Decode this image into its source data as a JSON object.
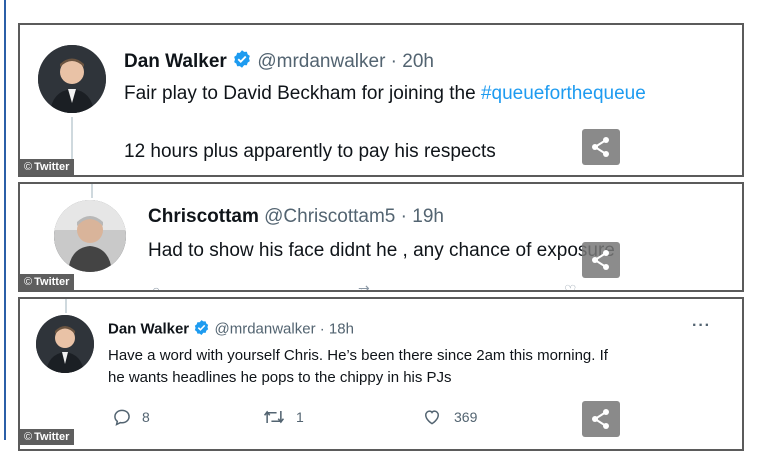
{
  "credit_label": "Twitter",
  "credit_symbol": "©",
  "tweets": [
    {
      "name": "Dan Walker",
      "handle": "@mrdanwalker",
      "separator": "·",
      "time": "20h",
      "text_before": "Fair play to David Beckham for joining the ",
      "hashtag": "#queueforthequeue",
      "text_second": "12 hours plus apparently to pay his respects"
    },
    {
      "name": "Chriscottam",
      "handle": "@Chriscottam5",
      "separator": "·",
      "time": "19h",
      "text": "Had to show his face didnt he , any chance of exposure"
    },
    {
      "name": "Dan Walker",
      "handle": "@mrdanwalker",
      "separator": "·",
      "time": "18h",
      "more": "···",
      "text_line1": "Have a word with yourself Chris. He’s been there since 2am this morning. If",
      "text_line2": "he wants headlines he pops to the chippy in his PJs",
      "replies": "8",
      "retweets": "1",
      "likes": "369"
    }
  ],
  "colors": {
    "verified": "#1d9bf0",
    "hashtag": "#1d9bf0",
    "credit_bg": "#5e5e5e",
    "border": "#5b5b5b"
  },
  "icons": [
    "verified-badge-icon",
    "share-icon",
    "reply-icon",
    "retweet-icon",
    "like-icon",
    "more-icon"
  ]
}
